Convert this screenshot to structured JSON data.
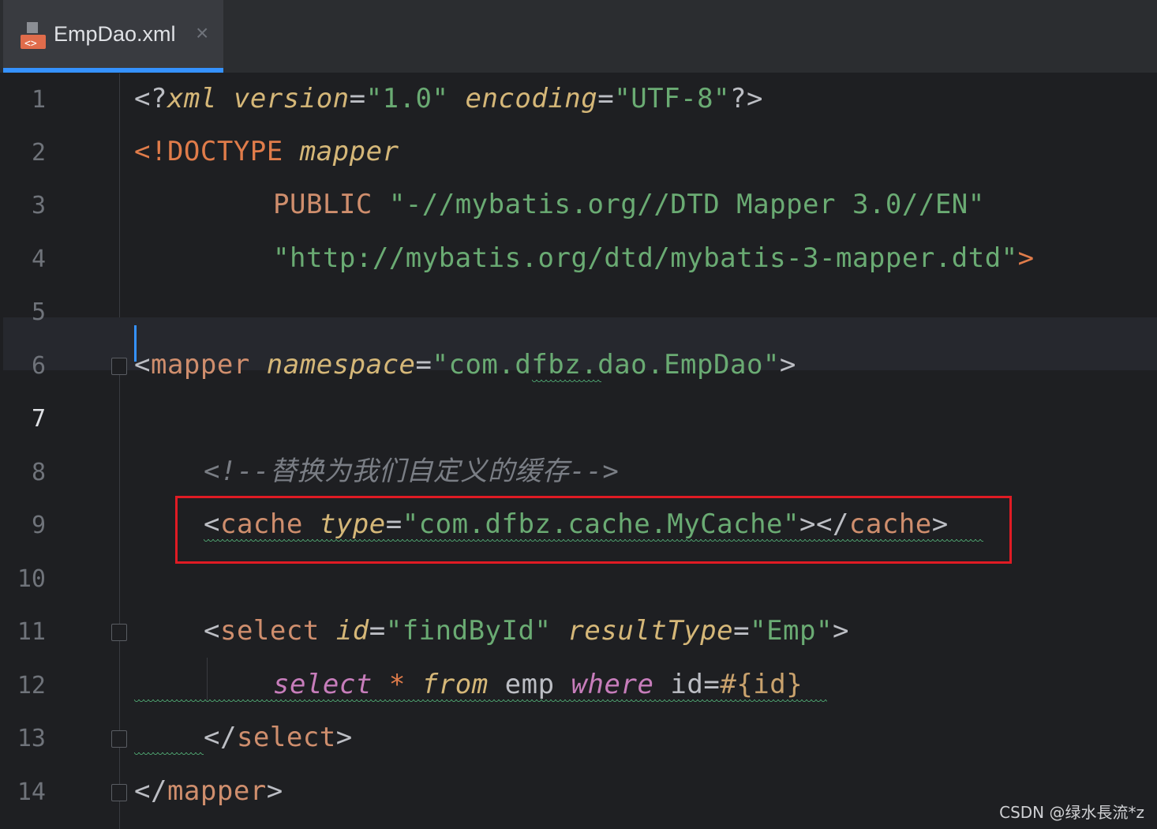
{
  "tab": {
    "filename": "EmpDao.xml",
    "close": "×"
  },
  "lines": [
    {
      "num": "1"
    },
    {
      "num": "2"
    },
    {
      "num": "3"
    },
    {
      "num": "4"
    },
    {
      "num": "5"
    },
    {
      "num": "6"
    },
    {
      "num": "7"
    },
    {
      "num": "8"
    },
    {
      "num": "9"
    },
    {
      "num": "10"
    },
    {
      "num": "11"
    },
    {
      "num": "12"
    },
    {
      "num": "13"
    },
    {
      "num": "14"
    }
  ],
  "code": {
    "l1": {
      "open": "<?",
      "xml": "xml",
      "attr1": "version",
      "eq1": "=",
      "val1": "\"1.0\"",
      "attr2": "encoding",
      "eq2": "=",
      "val2": "\"UTF-8\"",
      "close": "?>"
    },
    "l2": {
      "open": "<!",
      "doctype": "DOCTYPE",
      "name": "mapper"
    },
    "l3": {
      "public": "PUBLIC",
      "val": "\"-//mybatis.org//DTD Mapper 3.0//EN\""
    },
    "l4": {
      "val": "\"http://mybatis.org/dtd/mybatis-3-mapper.dtd\"",
      "close": ">"
    },
    "l6": {
      "open": "<",
      "tag": "mapper",
      "attr": "namespace",
      "eq": "=",
      "val": "\"com.dfbz.dao.EmpDao\"",
      "close": ">"
    },
    "l8": {
      "comment": "<!--替换为我们自定义的缓存-->"
    },
    "l9": {
      "open": "<",
      "tag": "cache",
      "attr": "type",
      "eq": "=",
      "val": "\"com.dfbz.cache.MyCache\"",
      "mid": "></",
      "tag2": "cache",
      "close": ">"
    },
    "l11": {
      "open": "<",
      "tag": "select",
      "attr1": "id",
      "eq1": "=",
      "val1": "\"findById\"",
      "attr2": "resultType",
      "eq2": "=",
      "val2": "\"Emp\"",
      "close": ">"
    },
    "l12": {
      "kw1": "select",
      "star": "*",
      "kw2": "from",
      "table": "emp",
      "kw3": "where",
      "col": "id",
      "eq": "=",
      "param": "#{id}"
    },
    "l13": {
      "open": "</",
      "tag": "select",
      "close": ">"
    },
    "l14": {
      "open": "</",
      "tag": "mapper",
      "close": ">"
    }
  },
  "watermark": "CSDN @绿水長流*z",
  "colors": {
    "accent": "#3592ff",
    "highlight": "#e01b24"
  }
}
